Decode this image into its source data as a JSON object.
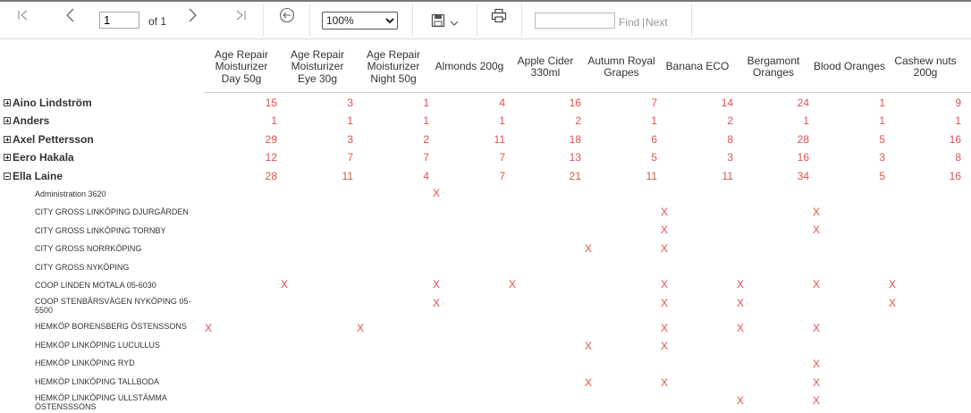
{
  "toolbar": {
    "page_value": "1",
    "of_label": "of 1",
    "zoom_value": "100%",
    "zoom_options": [
      "100%"
    ],
    "find_label": "Find",
    "next_label": "Next",
    "separator_char": "|"
  },
  "columns": [
    "Age Repair Moisturizer Day 50g",
    "Age Repair Moisturizer Eye 30g",
    "Age Repair Moisturizer Night 50g",
    "Almonds 200g",
    "Apple Cider 330ml",
    "Autumn Royal Grapes",
    "Banana ECO",
    "Bergamont Oranges",
    "Blood Oranges",
    "Cashew nuts 200g"
  ],
  "groups": [
    {
      "name": "Aino Lindström",
      "expanded": false,
      "values": [
        "15",
        "3",
        "1",
        "4",
        "16",
        "7",
        "14",
        "24",
        "1",
        "9"
      ]
    },
    {
      "name": "Anders",
      "expanded": false,
      "values": [
        "1",
        "1",
        "1",
        "1",
        "2",
        "1",
        "2",
        "1",
        "1",
        "1"
      ]
    },
    {
      "name": "Axel Pettersson",
      "expanded": false,
      "values": [
        "29",
        "3",
        "2",
        "11",
        "18",
        "6",
        "8",
        "28",
        "5",
        "16"
      ]
    },
    {
      "name": "Eero Hakala",
      "expanded": false,
      "values": [
        "12",
        "7",
        "7",
        "7",
        "13",
        "5",
        "3",
        "16",
        "3",
        "8"
      ]
    },
    {
      "name": "Ella Laine",
      "expanded": true,
      "values": [
        "28",
        "11",
        "4",
        "7",
        "21",
        "11",
        "11",
        "34",
        "5",
        "16"
      ]
    }
  ],
  "stores": [
    {
      "name": "Administration 3620",
      "marks": [
        "",
        "",
        "",
        "X",
        "",
        "",
        "",
        "",
        "",
        ""
      ]
    },
    {
      "name": "CITY GROSS LINKÖPING DJURGÅRDEN",
      "marks": [
        "",
        "",
        "",
        "",
        "",
        "",
        "X",
        "",
        "X",
        ""
      ]
    },
    {
      "name": "CITY GROSS LINKÖPING TORNBY",
      "marks": [
        "",
        "",
        "",
        "",
        "",
        "",
        "X",
        "",
        "X",
        ""
      ]
    },
    {
      "name": "CITY GROSS NORRKÖPING",
      "marks": [
        "",
        "",
        "",
        "",
        "",
        "X",
        "X",
        "",
        "",
        ""
      ]
    },
    {
      "name": "CITY GROSS NYKÖPING",
      "marks": [
        "",
        "",
        "",
        "",
        "",
        "",
        "",
        "",
        "",
        ""
      ]
    },
    {
      "name": "COOP LINDEN MOTALA  05-6030",
      "marks": [
        "",
        "X",
        "",
        "X",
        "X",
        "",
        "X",
        "X",
        "X",
        "X"
      ]
    },
    {
      "name": "COOP STENBÄRSVÄGEN NYKÖPING 05-5500",
      "marks": [
        "",
        "",
        "",
        "X",
        "",
        "",
        "X",
        "X",
        "",
        "X"
      ]
    },
    {
      "name": "HEMKÖP BORENSBERG ÖSTENSSONS",
      "marks": [
        "X",
        "",
        "X",
        "",
        "",
        "",
        "X",
        "X",
        "X",
        ""
      ]
    },
    {
      "name": "HEMKÖP LINKÖPING LUCULLUS",
      "marks": [
        "",
        "",
        "",
        "",
        "",
        "X",
        "X",
        "",
        "",
        ""
      ]
    },
    {
      "name": "HEMKÖP LINKÖPING RYD",
      "marks": [
        "",
        "",
        "",
        "",
        "",
        "",
        "",
        "",
        "X",
        ""
      ]
    },
    {
      "name": "HEMKÖP LINKÖPING TALLBODA",
      "marks": [
        "",
        "",
        "",
        "",
        "",
        "X",
        "X",
        "",
        "X",
        ""
      ]
    },
    {
      "name": "HEMKÖP LINKÖPING ULLSTÄMMA ÖSTENSSSONS",
      "marks": [
        "",
        "",
        "",
        "",
        "",
        "",
        "",
        "X",
        "X",
        ""
      ]
    }
  ],
  "colors": {
    "value_red": "#e05050",
    "text": "#333333"
  }
}
